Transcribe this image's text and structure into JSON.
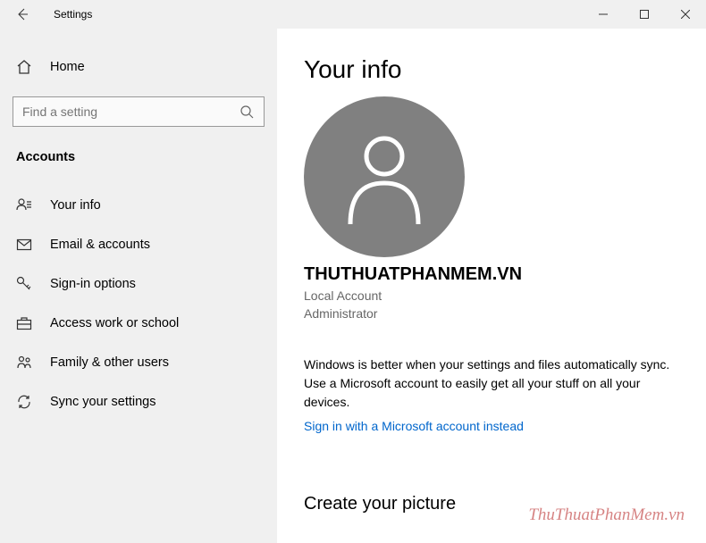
{
  "window": {
    "title": "Settings"
  },
  "home": {
    "label": "Home"
  },
  "search": {
    "placeholder": "Find a setting"
  },
  "section": {
    "header": "Accounts"
  },
  "nav": {
    "items": [
      {
        "icon": "user-badge-icon",
        "label": "Your info"
      },
      {
        "icon": "email-icon",
        "label": "Email & accounts"
      },
      {
        "icon": "key-icon",
        "label": "Sign-in options"
      },
      {
        "icon": "briefcase-icon",
        "label": "Access work or school"
      },
      {
        "icon": "family-icon",
        "label": "Family & other users"
      },
      {
        "icon": "sync-icon",
        "label": "Sync your settings"
      }
    ]
  },
  "main": {
    "title": "Your info",
    "username": "THUTHUATPHANMEM.VN",
    "account_type": "Local Account",
    "account_role": "Administrator",
    "sync_text": "Windows is better when your settings and files automatically sync. Use a Microsoft account to easily get all your stuff on all your devices.",
    "sign_in_link": "Sign in with a Microsoft account instead",
    "picture_heading": "Create your picture"
  },
  "watermark": "ThuThuatPhanMem.vn"
}
